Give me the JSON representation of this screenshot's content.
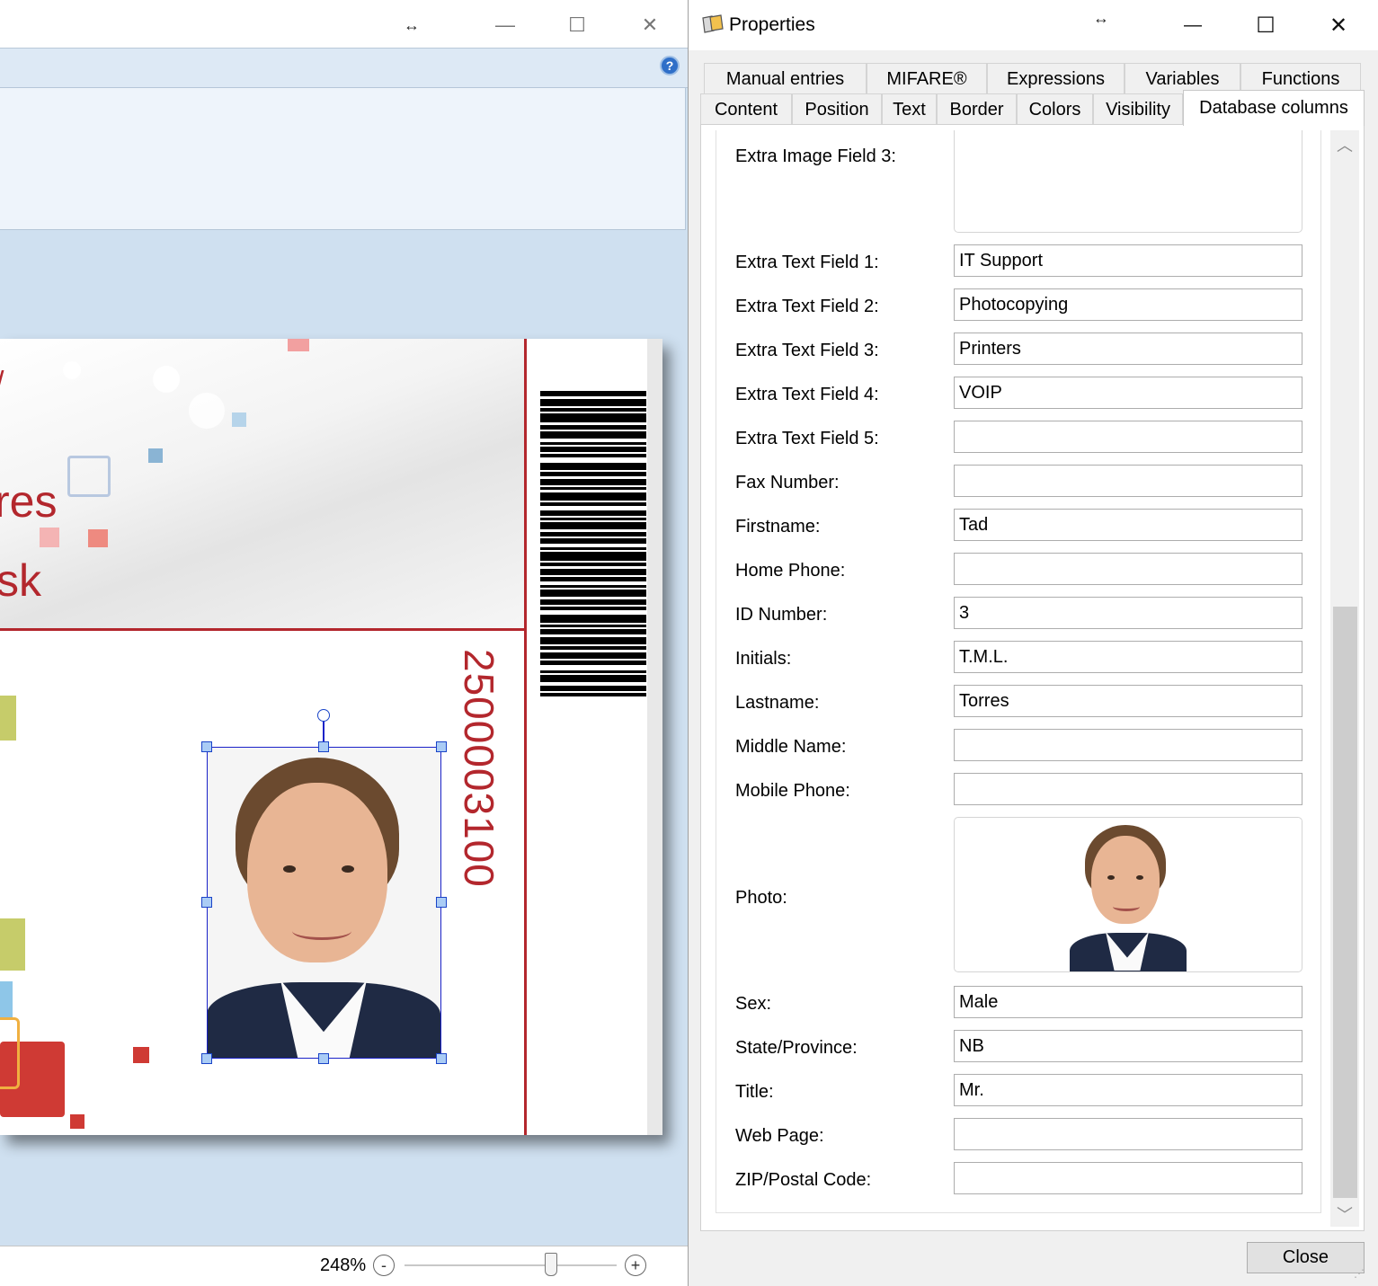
{
  "designer": {
    "controls": {
      "minimize": "—",
      "maximize": "☐",
      "close": "✕",
      "resize": "↔"
    },
    "help_icon": "?",
    "card": {
      "text_line1": "res",
      "text_line2": "sk",
      "text_line0": "/",
      "id_number": "2500003100",
      "accent_color": "#b3272d"
    },
    "zoom": {
      "label": "248%",
      "minus": "-",
      "plus": "+",
      "value_fraction": 0.69
    }
  },
  "properties": {
    "title": "Properties",
    "controls": {
      "resize": "↔",
      "minimize": "—",
      "maximize": "☐",
      "close": "✕"
    },
    "tabs_row1": [
      "Manual entries",
      "MIFARE®",
      "Expressions",
      "Variables",
      "Functions"
    ],
    "tabs_row2": [
      "Content",
      "Position",
      "Text",
      "Border",
      "Colors",
      "Visibility",
      "Database columns"
    ],
    "active_tab": "Database columns",
    "fields": {
      "extra_image_3": {
        "label": "Extra Image Field 3:"
      },
      "extra_text_1": {
        "label": "Extra Text Field 1:",
        "value": "IT Support"
      },
      "extra_text_2": {
        "label": "Extra Text Field 2:",
        "value": "Photocopying"
      },
      "extra_text_3": {
        "label": "Extra Text Field 3:",
        "value": "Printers"
      },
      "extra_text_4": {
        "label": "Extra Text Field 4:",
        "value": "VOIP"
      },
      "extra_text_5": {
        "label": "Extra Text Field 5:",
        "value": ""
      },
      "fax": {
        "label": "Fax Number:",
        "value": ""
      },
      "firstname": {
        "label": "Firstname:",
        "value": "Tad"
      },
      "home_phone": {
        "label": "Home Phone:",
        "value": ""
      },
      "id_number": {
        "label": "ID Number:",
        "value": "3"
      },
      "initials": {
        "label": "Initials:",
        "value": "T.M.L."
      },
      "lastname": {
        "label": "Lastname:",
        "value": "Torres"
      },
      "middle_name": {
        "label": "Middle Name:",
        "value": ""
      },
      "mobile_phone": {
        "label": "Mobile Phone:",
        "value": ""
      },
      "photo": {
        "label": "Photo:"
      },
      "sex": {
        "label": "Sex:",
        "value": "Male"
      },
      "state": {
        "label": "State/Province:",
        "value": "NB"
      },
      "title": {
        "label": "Title:",
        "value": "Mr."
      },
      "web_page": {
        "label": "Web Page:",
        "value": ""
      },
      "zip": {
        "label": "ZIP/Postal Code:",
        "value": ""
      }
    },
    "scroll": {
      "up": "︿",
      "down": "﹀"
    },
    "close_button": "Close"
  }
}
